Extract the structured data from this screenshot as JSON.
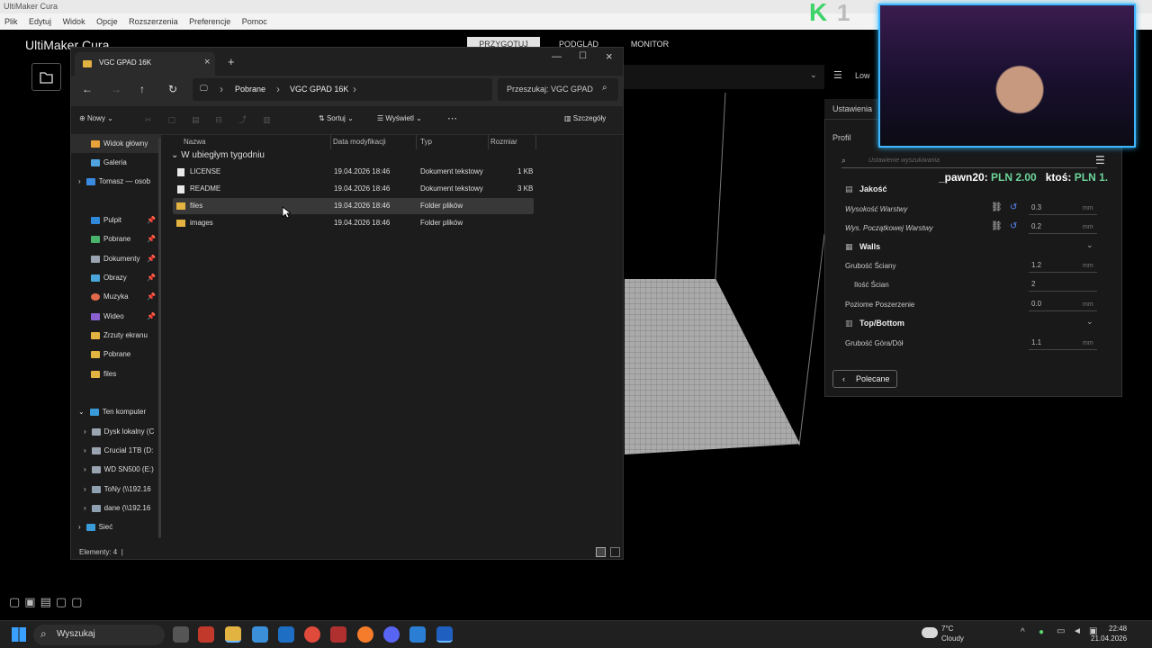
{
  "cura": {
    "title": "UltiMaker Cura",
    "menu": [
      "Plik",
      "Edytuj",
      "Widok",
      "Opcje",
      "Rozszerzenia",
      "Preferencje",
      "Pomoc"
    ],
    "logo": "UltiMaker Cura",
    "tabs": [
      "PRZYGOTUJ",
      "PODGLĄD",
      "MONITOR"
    ],
    "profile_short": "Low",
    "settings_title": "Ustawienia",
    "profile_label": "Profil",
    "search_placeholder": "Ustawienie wyszukiwania",
    "sections": {
      "quality": "Jakość",
      "walls": "Walls",
      "topbottom": "Top/Bottom"
    },
    "settings": [
      {
        "label": "Wysokość Warstwy",
        "value": "0.3",
        "unit": "mm"
      },
      {
        "label": "Wys. Początkowej Warstwy",
        "value": "0.2",
        "unit": "mm"
      },
      {
        "label": "Grubość Ściany",
        "value": "1.2",
        "unit": "mm"
      },
      {
        "label": "Ilość Ścian",
        "value": "2",
        "unit": ""
      },
      {
        "label": "Poziome Poszerzenie",
        "value": "0.0",
        "unit": "mm"
      },
      {
        "label": "Grubość Góra/Dół",
        "value": "1.1",
        "unit": "mm"
      }
    ],
    "recommended_button": "Polecane"
  },
  "stream": {
    "donation1_name": "_pawn20:",
    "donation1_amount": "PLN 2.00",
    "donation2_name": "ktoś:",
    "donation2_amount": "PLN 1."
  },
  "explorer": {
    "tab_title": "VGC GPAD 16K",
    "breadcrumb": [
      "Pobrane",
      "VGC GPAD 16K"
    ],
    "search_placeholder": "Przeszukaj: VGC GPAD",
    "toolbar": {
      "new": "Nowy",
      "sort": "Sortuj",
      "view": "Wyświetl",
      "details": "Szczegóły"
    },
    "nav": [
      {
        "label": "Widok główny"
      },
      {
        "label": "Galeria"
      },
      {
        "label": "Tomasz — osob"
      },
      {
        "label": "Pulpit"
      },
      {
        "label": "Pobrane"
      },
      {
        "label": "Dokumenty"
      },
      {
        "label": "Obrazy"
      },
      {
        "label": "Muzyka"
      },
      {
        "label": "Wideo"
      },
      {
        "label": "Zrzuty ekranu"
      },
      {
        "label": "Pobrane"
      },
      {
        "label": "files"
      },
      {
        "label": "Ten komputer"
      },
      {
        "label": "Dysk lokalny (C"
      },
      {
        "label": "Crucial 1TB (D:"
      },
      {
        "label": "WD SN500 (E:)"
      },
      {
        "label": "ToNy (\\\\192.16"
      },
      {
        "label": "dane (\\\\192.16"
      },
      {
        "label": "Sieć"
      }
    ],
    "columns": [
      "Nazwa",
      "Data modyfikacji",
      "Typ",
      "Rozmiar"
    ],
    "group": "W ubiegłym tygodniu",
    "files": [
      {
        "name": "LICENSE",
        "date": "19.04.2026 18:46",
        "type": "Dokument tekstowy",
        "size": "1 KB"
      },
      {
        "name": "README",
        "date": "19.04.2026 18:46",
        "type": "Dokument tekstowy",
        "size": "3 KB"
      },
      {
        "name": "files",
        "date": "19.04.2026 18:46",
        "type": "Folder plików",
        "size": ""
      },
      {
        "name": "images",
        "date": "19.04.2026 18:46",
        "type": "Folder plików",
        "size": ""
      }
    ],
    "status": "Elementy: 4"
  },
  "taskbar": {
    "search": "Wyszukaj",
    "temp": "7°C",
    "weather": "Cloudy",
    "time": "22:48",
    "date": "21.04.2026"
  }
}
